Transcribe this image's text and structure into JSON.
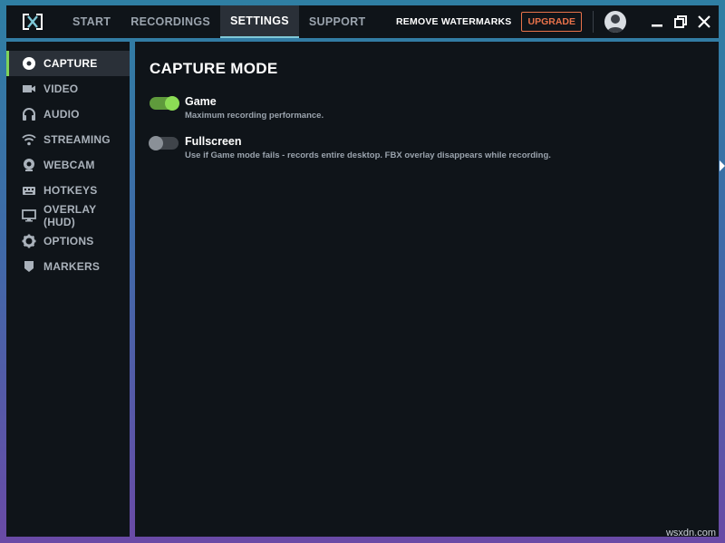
{
  "topbar": {
    "tabs": [
      {
        "label": "START"
      },
      {
        "label": "RECORDINGS"
      },
      {
        "label": "SETTINGS"
      },
      {
        "label": "SUPPORT"
      }
    ],
    "remove_watermarks": "REMOVE WATERMARKS",
    "upgrade": "UPGRADE"
  },
  "sidebar": {
    "items": [
      {
        "label": "CAPTURE",
        "icon": "record-icon"
      },
      {
        "label": "VIDEO",
        "icon": "video-camera-icon"
      },
      {
        "label": "AUDIO",
        "icon": "headphones-icon"
      },
      {
        "label": "STREAMING",
        "icon": "wifi-icon"
      },
      {
        "label": "WEBCAM",
        "icon": "webcam-icon"
      },
      {
        "label": "HOTKEYS",
        "icon": "keyboard-icon"
      },
      {
        "label": "OVERLAY (HUD)",
        "icon": "monitor-icon"
      },
      {
        "label": "OPTIONS",
        "icon": "gear-icon"
      },
      {
        "label": "MARKERS",
        "icon": "marker-icon"
      }
    ]
  },
  "main": {
    "title": "CAPTURE MODE",
    "options": [
      {
        "title": "Game",
        "desc": "Maximum recording performance.",
        "enabled": true
      },
      {
        "title": "Fullscreen",
        "desc": "Use if Game mode fails - records entire desktop. FBX overlay disappears while recording.",
        "enabled": false
      }
    ]
  },
  "watermark": "wsxdn.com",
  "colors": {
    "accent_green": "#8cdc55",
    "upgrade_orange": "#e8724a",
    "active_tab_underline": "#7fc8d8",
    "panel_bg": "#0f1419"
  }
}
